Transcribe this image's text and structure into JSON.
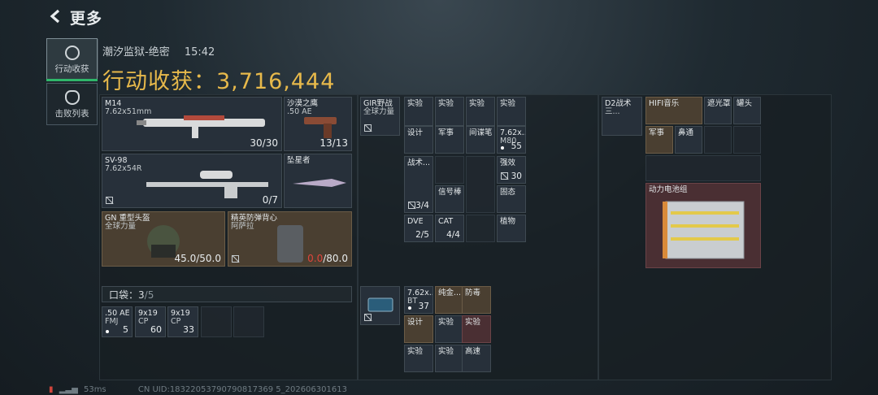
{
  "header": {
    "back_label": "更多",
    "map_name": "潮汐监狱-绝密",
    "time": "15:42"
  },
  "sidebar": {
    "tabs": [
      {
        "label": "行动收获",
        "active": true
      },
      {
        "label": "击败列表",
        "active": false
      }
    ]
  },
  "harvest": {
    "label": "行动收获：",
    "value": "3,716,444"
  },
  "weapons": {
    "m14": {
      "name": "M14",
      "caliber": "7.62x51mm",
      "ammo": "30/30"
    },
    "desert": {
      "name": "沙漠之鹰",
      "caliber": ".50 AE",
      "ammo": "13/13"
    },
    "sv98": {
      "name": "SV-98",
      "caliber": "7.62x54R",
      "ammo": "0/7"
    },
    "knife": {
      "name": "坠星者"
    },
    "helmet": {
      "name": "GN 重型头盔",
      "sub": "全球力量",
      "durability": "45.0/50.0"
    },
    "armor": {
      "name": "精英防弹背心",
      "sub": "阿萨拉",
      "durability_cur": "0.0",
      "durability_max": "/80.0"
    }
  },
  "pocket": {
    "label": "口袋：",
    "count": "3",
    "max": "/5",
    "items": [
      {
        "name": ".50 AE",
        "sub": "FMJ",
        "count": "5"
      },
      {
        "name": "9x19",
        "sub": "CP",
        "count": "60"
      },
      {
        "name": "9x19",
        "sub": "CP",
        "count": "33"
      }
    ]
  },
  "rig": {
    "name": "GIR野战",
    "sub": "全球力量"
  },
  "rig_items": [
    {
      "name": "实验"
    },
    {
      "name": "实验"
    },
    {
      "name": "实验"
    },
    {
      "name": "实验"
    },
    {
      "name": "设计"
    },
    {
      "name": "军事"
    },
    {
      "name": "间谍笔"
    },
    {
      "name": "7.62x...",
      "sub": "M80",
      "count": "55"
    }
  ],
  "rig_lower": [
    {
      "name": "战术...",
      "count": "3/4"
    },
    {
      "name": "信号棒"
    },
    {
      "name": "强效",
      "count": "30"
    },
    {
      "name": "固态"
    },
    {
      "name": "DVE",
      "count": "2/5"
    },
    {
      "name": "CAT",
      "count": "4/4"
    },
    {
      "name": "植物"
    }
  ],
  "case": {
    "items": [
      {
        "name": "7.62x...",
        "sub": "BT",
        "count": "37"
      },
      {
        "name": "纯金..."
      },
      {
        "name": "防毒"
      },
      {
        "name": "设计"
      },
      {
        "name": "实验"
      },
      {
        "name": "实验"
      },
      {
        "name": "实验"
      },
      {
        "name": "实验"
      },
      {
        "name": "高速"
      }
    ]
  },
  "backpack": {
    "name": "D2战术",
    "sub": "三..."
  },
  "bag_items": [
    {
      "name": "HIFI音乐"
    },
    {
      "name": "遮光罩"
    },
    {
      "name": "罐头"
    },
    {
      "name": "军事"
    },
    {
      "name": "鼻通"
    }
  ],
  "battery": {
    "name": "动力电池组"
  },
  "footer": {
    "ping": "53ms",
    "uid": "CN UID:18322053790790817369 5_202606301613"
  },
  "colors": {
    "accent": "#e7b94b",
    "active_indicator": "#2fb66a",
    "danger": "#e0453c"
  }
}
